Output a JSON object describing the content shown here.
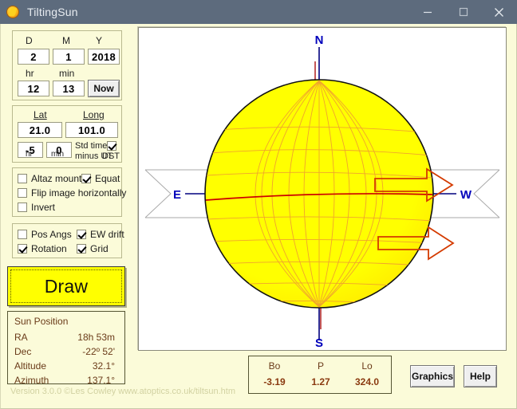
{
  "window": {
    "title": "TiltingSun",
    "icon": "sun-icon",
    "controls": {
      "minimize": "minimize-icon",
      "maximize": "maximize-icon",
      "close": "close-icon"
    }
  },
  "datetime_panel": {
    "day_label": "D",
    "month_label": "M",
    "year_label": "Y",
    "day_value": "2",
    "month_value": "1",
    "year_value": "2018",
    "hour_label": "hr",
    "minute_label": "min",
    "hour_value": "12",
    "minute_value": "13",
    "now_button": "Now"
  },
  "location_panel": {
    "lat_label": "Lat",
    "long_label": "Long",
    "lat_value": "21.0",
    "long_value": "101.0",
    "offset_hr_value": "-5",
    "offset_min_value": "0",
    "offset_hr_label": "hr",
    "offset_min_label": "min",
    "std_time_line1": "Std time",
    "std_time_line2": "minus UT",
    "dst_label": "DST",
    "dst_checked": true
  },
  "mount_panel": {
    "options": [
      {
        "label": "Altaz mount",
        "checked": false,
        "name": "altaz-mount"
      },
      {
        "label": "Equat",
        "checked": true,
        "name": "equat"
      },
      {
        "label": "Flip image horizontally",
        "checked": false,
        "name": "flip-horizontal"
      },
      {
        "label": "Invert",
        "checked": false,
        "name": "invert"
      }
    ]
  },
  "display_panel": {
    "options": [
      {
        "label": "Pos Angs",
        "checked": false,
        "name": "pos-angs"
      },
      {
        "label": "EW drift",
        "checked": true,
        "name": "ew-drift"
      },
      {
        "label": "Rotation",
        "checked": true,
        "name": "rotation"
      },
      {
        "label": "Grid",
        "checked": true,
        "name": "grid"
      }
    ]
  },
  "draw_button": {
    "label": "Draw"
  },
  "sun_position": {
    "title": "Sun Position",
    "rows": [
      {
        "key": "RA",
        "value": "18h 53m"
      },
      {
        "key": "Dec",
        "value": "-22º 52'"
      },
      {
        "key": "Altitude",
        "value": "32.1°"
      },
      {
        "key": "Azimuth",
        "value": "137.1°"
      }
    ]
  },
  "version_bar": {
    "text": "Version 3.0.0   ©Les Cowley www.atoptics.co.uk/tiltsun.htm"
  },
  "solar_params": {
    "columns": [
      {
        "head": "Bo",
        "value": "-3.19"
      },
      {
        "head": "P",
        "value": "1.27"
      },
      {
        "head": "Lo",
        "value": "324.0"
      }
    ]
  },
  "footer_buttons": {
    "graphics": "Graphics",
    "help": "Help"
  },
  "diagram": {
    "cardinal_north": "N",
    "cardinal_south": "S",
    "cardinal_east": "E",
    "cardinal_west": "W",
    "sun_fill": "#ffff00",
    "grid_color": "#f0a030",
    "equator_color": "#cc0000",
    "axis_color": "#00007f",
    "drift_arrow_color": "#d43a00"
  },
  "colors": {
    "titlebar": "#5d6b7d",
    "client_bg": "#fbfbd9",
    "panel_border": "#b9b98f",
    "accent_text": "#6a3b19",
    "value_text": "#8a3a10",
    "draw_button": "#ffff00"
  }
}
